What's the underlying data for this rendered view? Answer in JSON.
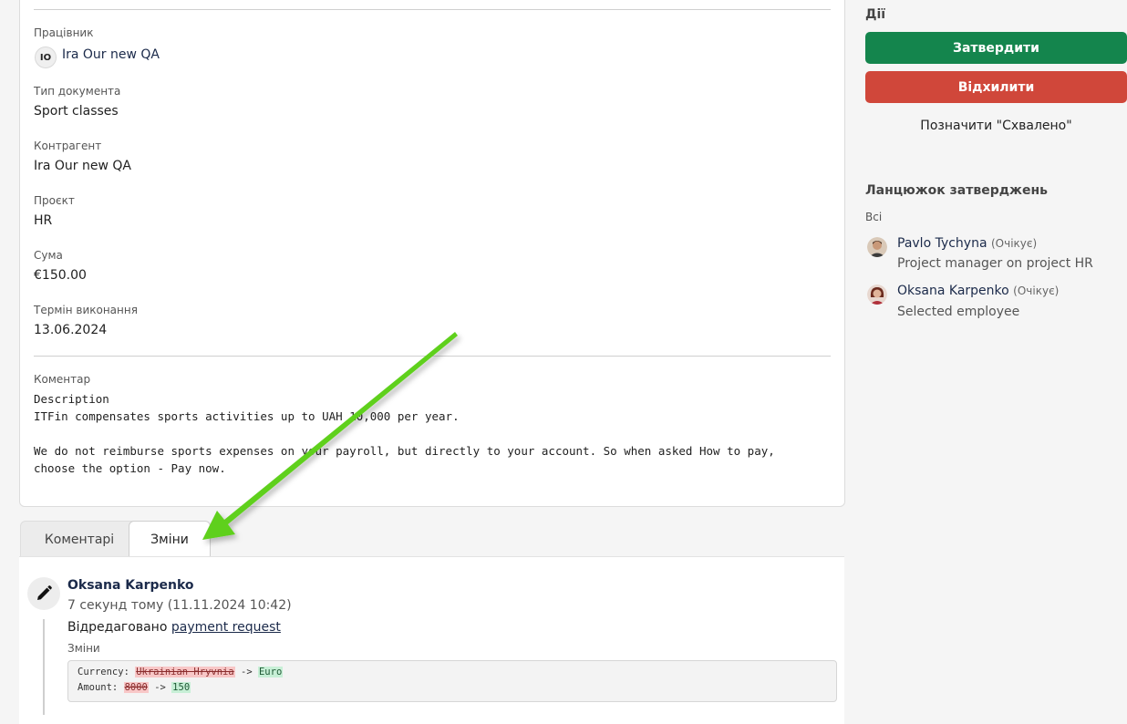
{
  "details": {
    "employee_label": "Працівник",
    "employee_initials": "IO",
    "employee_name": "Ira Our new QA",
    "doc_type_label": "Тип документа",
    "doc_type_value": "Sport classes",
    "counterparty_label": "Контрагент",
    "counterparty_value": "Ira Our new QA",
    "project_label": "Проєкт",
    "project_value": "HR",
    "amount_label": "Сума",
    "amount_value": "€150.00",
    "due_label": "Термін виконання",
    "due_value": "13.06.2024",
    "comment_label": "Коментар",
    "comment_lines": [
      "Description",
      "ITFin compensates sports activities up to UAH 10,000 per year.",
      "",
      "We do not reimburse sports expenses on your payroll, but directly to your account. So when asked How to pay,",
      "choose the option - Pay now."
    ]
  },
  "actions": {
    "title": "Дії",
    "approve": "Затвердити",
    "reject": "Відхилити",
    "mark_approved": "Позначити \"Схвалено\""
  },
  "chain": {
    "title": "Ланцюжок затверджень",
    "filter": "Всі",
    "approvers": [
      {
        "name": "Pavlo Tychyna",
        "status": "(Очікує)",
        "role": "Project manager on project HR"
      },
      {
        "name": "Oksana Karpenko",
        "status": "(Очікує)",
        "role": "Selected employee"
      }
    ]
  },
  "tabs": [
    {
      "label": "Коментарі"
    },
    {
      "label": "Зміни"
    }
  ],
  "history": {
    "author": "Oksana Karpenko",
    "time": "7 секунд тому (11.11.2024 10:42)",
    "action_text": "Відредаговано ",
    "action_link": "payment request",
    "changes_label": "Зміни",
    "diffs": [
      {
        "field": "Currency: ",
        "old": "Ukrainian Hryvnia",
        "sep": " -> ",
        "new": "Euro"
      },
      {
        "field": "Amount: ",
        "old": "8000",
        "sep": " -> ",
        "new": "150"
      }
    ]
  },
  "colors": {
    "approve": "#14854d",
    "reject": "#d0473a",
    "arrow": "#5ed01e"
  }
}
